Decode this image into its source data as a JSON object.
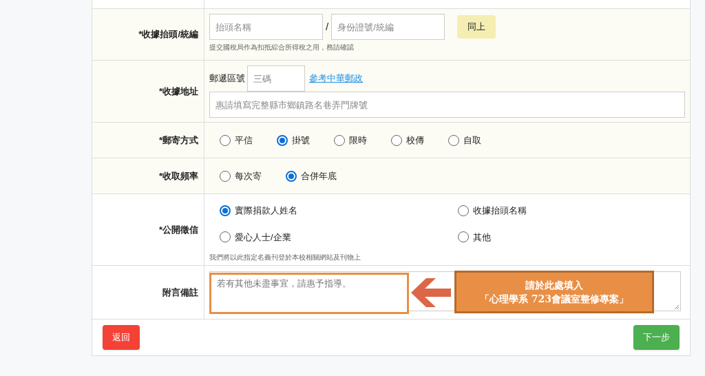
{
  "receipt_title": {
    "label": "*收據抬頭/統編",
    "name_placeholder": "抬頭名稱",
    "separator": "/",
    "id_placeholder": "身份證號/統編",
    "same_button": "同上",
    "hint": "提交國稅局作為扣抵綜合所得稅之用，務請確認"
  },
  "receipt_address": {
    "label": "*收據地址",
    "zip_label": "郵遞區號",
    "zip_placeholder": "三碼",
    "zip_link": "參考中華郵政",
    "address_placeholder": "惠請填寫完整縣市鄉鎮路名巷弄門牌號"
  },
  "mail_method": {
    "label": "*郵寄方式",
    "options": [
      {
        "label": "平信",
        "selected": false
      },
      {
        "label": "掛號",
        "selected": true
      },
      {
        "label": "限時",
        "selected": false
      },
      {
        "label": "校傳",
        "selected": false
      },
      {
        "label": "自取",
        "selected": false
      }
    ]
  },
  "frequency": {
    "label": "*收取頻率",
    "options": [
      {
        "label": "每次寄",
        "selected": false
      },
      {
        "label": "合併年底",
        "selected": true
      }
    ]
  },
  "public_credit": {
    "label": "*公開徵信",
    "options": [
      {
        "label": "實際捐款人姓名",
        "selected": true
      },
      {
        "label": "收據抬頭名稱",
        "selected": false
      },
      {
        "label": "愛心人士/企業",
        "selected": false
      },
      {
        "label": "其他",
        "selected": false
      }
    ],
    "hint": "我們將以此指定名義刊登於本校相關網站及刊物上"
  },
  "note": {
    "label": "附言備註",
    "placeholder": "若有其他未盡事宜，請惠予指導。",
    "callout": [
      "請於此處填入",
      "「心理學系 723會議室整修專案」"
    ]
  },
  "buttons": {
    "back": "返回",
    "next": "下一步"
  }
}
